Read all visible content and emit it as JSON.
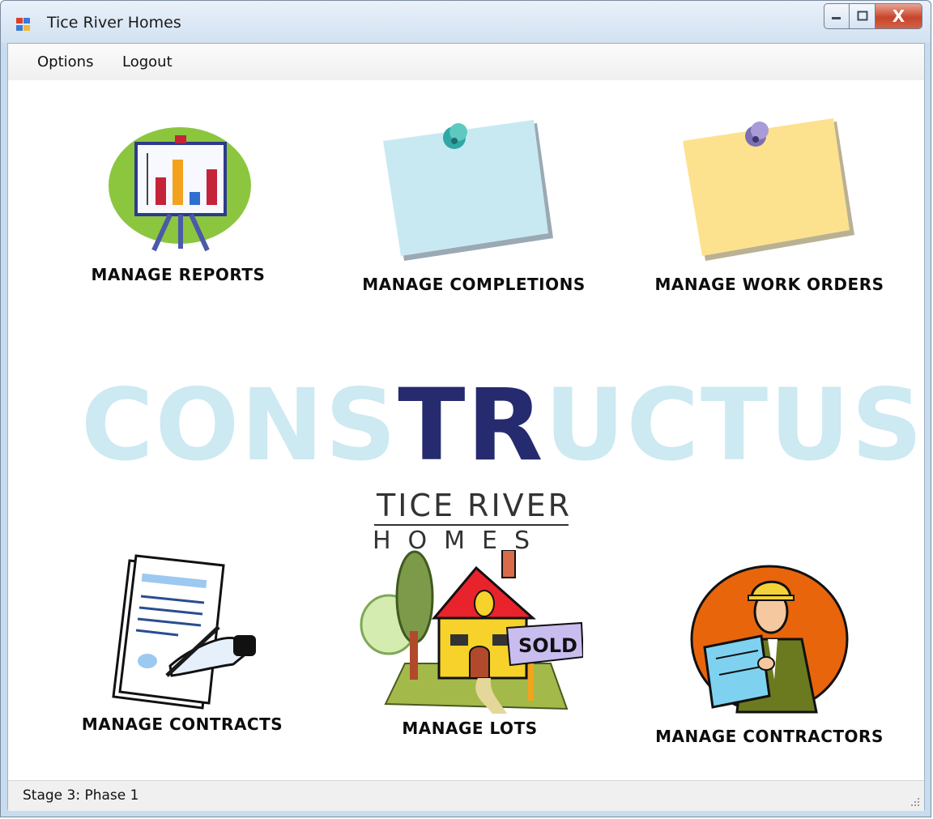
{
  "window": {
    "title": "Tice River Homes",
    "controls": {
      "minimize": "minimize",
      "maximize": "maximize",
      "close": "X"
    }
  },
  "menu": {
    "items": [
      "Options",
      "Logout"
    ]
  },
  "tiles": {
    "reports": {
      "label": "MANAGE REPORTS",
      "icon": "chart-easel-icon"
    },
    "completions": {
      "label": "MANAGE COMPLETIONS",
      "icon": "blue-sticky-note-icon"
    },
    "work_orders": {
      "label": "MANAGE WORK ORDERS",
      "icon": "yellow-sticky-note-icon"
    },
    "contracts": {
      "label": "MANAGE CONTRACTS",
      "icon": "signing-contract-icon"
    },
    "lots": {
      "label": "MANAGE LOTS",
      "icon": "house-sold-sign-icon",
      "sign_text": "SOLD"
    },
    "contractors": {
      "label": "MANAGE CONTRACTORS",
      "icon": "contractor-with-plans-icon"
    }
  },
  "logo": {
    "left_text": "CONS",
    "mark_text": "TR",
    "right_text": "UCTUS",
    "line1": "TICE RIVER",
    "line2": "HOMES"
  },
  "status": {
    "text": "Stage 3: Phase 1"
  },
  "colors": {
    "watermark": "#cde9f1",
    "mark": "#252b6e",
    "title_bar": "#d2e1f1",
    "close": "#c8442b"
  }
}
